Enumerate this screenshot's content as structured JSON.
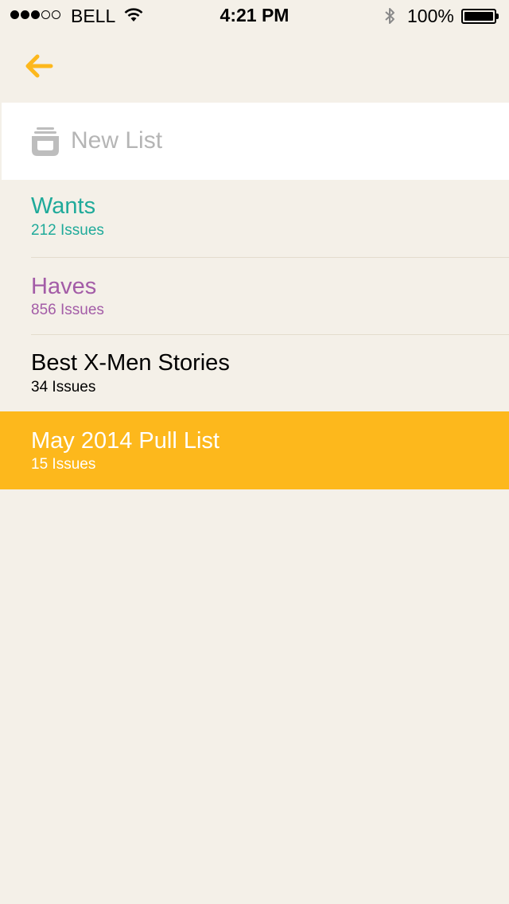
{
  "status_bar": {
    "carrier": "BELL",
    "time": "4:21 PM",
    "battery": "100%",
    "signal_bars_filled": 3,
    "signal_bars_total": 5
  },
  "nav": {
    "back_icon": "arrow-left-icon",
    "accent_color": "#fdb81c"
  },
  "new_list": {
    "label": "New List",
    "icon": "stack-icon"
  },
  "lists": [
    {
      "title": "Wants",
      "count": "212 Issues",
      "color": "#1faa9a"
    },
    {
      "title": "Haves",
      "count": "856 Issues",
      "color": "#a35ca7"
    },
    {
      "title": "Best X-Men Stories",
      "count": "34 Issues",
      "color": "#000000"
    },
    {
      "title": "May 2014 Pull List",
      "count": "15 Issues",
      "color": "#ffffff",
      "selected": true
    }
  ]
}
